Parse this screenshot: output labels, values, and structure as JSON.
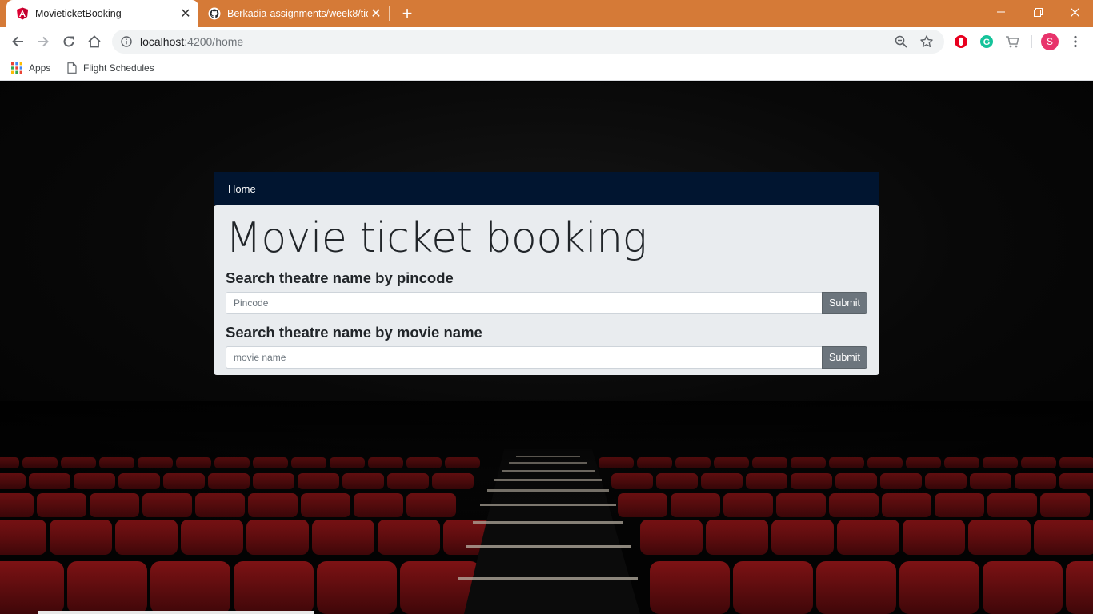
{
  "browser": {
    "tabs": [
      {
        "title": "MovieticketBooking",
        "icon": "angular-icon",
        "active": true
      },
      {
        "title": "Berkadia-assignments/week8/tic",
        "icon": "github-icon",
        "active": false
      }
    ],
    "url_host": "localhost",
    "url_path": ":4200/home",
    "bookmarks": [
      {
        "label": "Apps",
        "icon": "apps-grid-icon"
      },
      {
        "label": "Flight Schedules",
        "icon": "page-icon"
      }
    ],
    "profile_initial": "S",
    "colors": {
      "tabbar": "#d57a37",
      "profile": "#e8336b"
    }
  },
  "navbar": {
    "home_label": "Home",
    "background": "#011530"
  },
  "jumbotron": {
    "title": "Movie ticket booking",
    "pincode_heading": "Search theatre name by pincode",
    "pincode_placeholder": "Pincode",
    "pincode_submit": "Submit",
    "movie_heading": "Search theatre name by movie name",
    "movie_placeholder": "movie name",
    "movie_submit": "Submit"
  }
}
